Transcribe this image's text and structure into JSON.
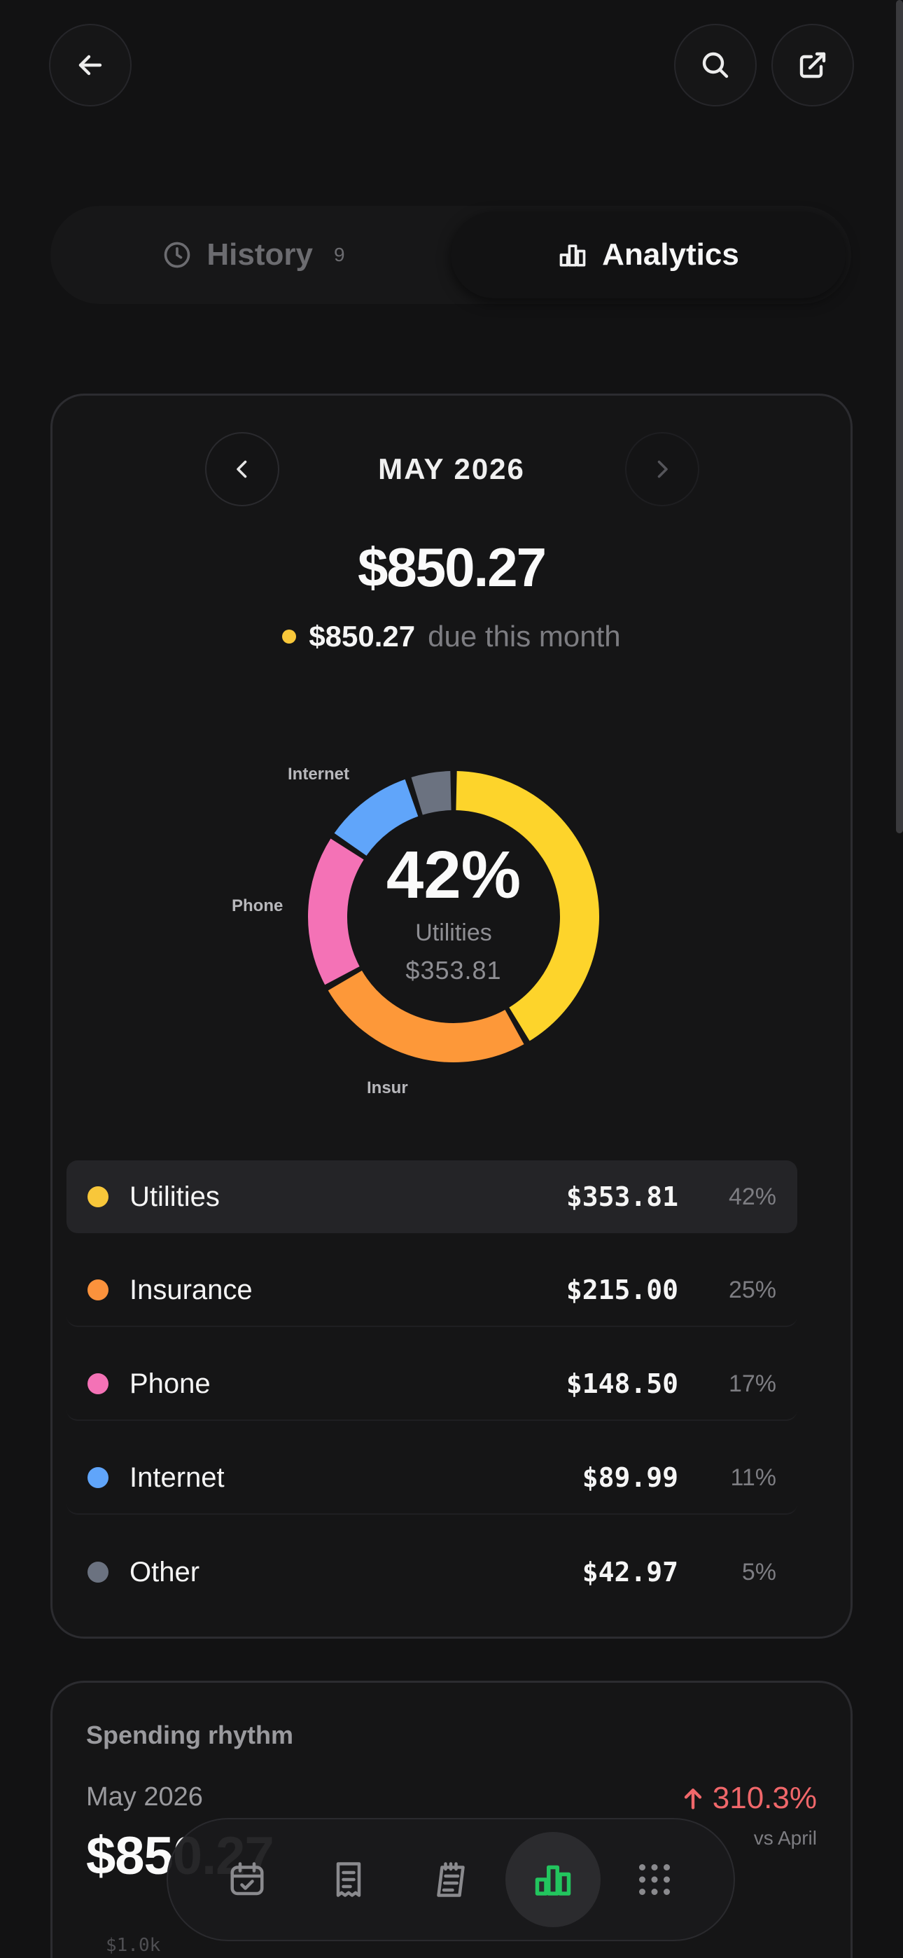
{
  "top_bar": {
    "back_icon": "arrow-left-icon",
    "search_icon": "search-icon",
    "share_icon": "external-link-icon"
  },
  "tabs": [
    {
      "label": "History",
      "count": "9",
      "icon": "clock-icon",
      "active": false
    },
    {
      "label": "Analytics",
      "icon": "bar-chart-icon",
      "active": true
    }
  ],
  "summary": {
    "month": "MAY 2026",
    "total": "$850.27",
    "due_amount": "$850.27",
    "due_text": "due this month",
    "due_dot_color": "#f8c73a"
  },
  "chart_data": {
    "type": "pie",
    "style": "donut",
    "categories": [
      "Utilities",
      "Insurance",
      "Phone",
      "Internet",
      "Other"
    ],
    "values": [
      353.81,
      215.0,
      148.5,
      89.99,
      42.97
    ],
    "colors": [
      "#fdd42b",
      "#fd9839",
      "#f472b6",
      "#60a5fa",
      "#6b7280"
    ],
    "slice_labels": [
      "Internet",
      "Phone",
      "Insur"
    ],
    "center": {
      "percent": "42%",
      "name": "Utilities",
      "amount": "$353.81"
    }
  },
  "legend": [
    {
      "name": "Utilities",
      "amount": "$353.81",
      "percent": "42%",
      "color": "#f8c73a",
      "selected": true
    },
    {
      "name": "Insurance",
      "amount": "$215.00",
      "percent": "25%",
      "color": "#fb923c",
      "selected": false
    },
    {
      "name": "Phone",
      "amount": "$148.50",
      "percent": "17%",
      "color": "#f472b6",
      "selected": false
    },
    {
      "name": "Internet",
      "amount": "$89.99",
      "percent": "11%",
      "color": "#60a5fa",
      "selected": false
    },
    {
      "name": "Other",
      "amount": "$42.97",
      "percent": "5%",
      "color": "#6b7280",
      "selected": false
    }
  ],
  "rhythm": {
    "title": "Spending rhythm",
    "month": "May 2026",
    "amount": "$850.27",
    "change": "310.3%",
    "change_color": "#f0676a",
    "vs": "vs April",
    "axis_top": "$1.0k"
  },
  "bottom_nav": [
    {
      "icon": "calendar-check-icon",
      "active": false
    },
    {
      "icon": "receipt-icon",
      "active": false
    },
    {
      "icon": "notepad-icon",
      "active": false
    },
    {
      "icon": "bar-chart-icon",
      "active": true
    },
    {
      "icon": "grid-dots-icon",
      "active": false
    }
  ],
  "accent_color": "#22c55e"
}
